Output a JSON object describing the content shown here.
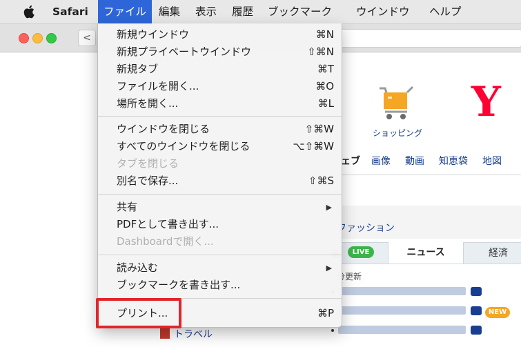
{
  "menubar": {
    "apple_icon": "apple-logo-icon",
    "app_name": "Safari",
    "items": [
      "ファイル",
      "編集",
      "表示",
      "履歴",
      "ブックマーク",
      "ウインドウ",
      "ヘルプ"
    ]
  },
  "window": {
    "back_glyph": "<"
  },
  "file_menu": {
    "group1": [
      {
        "label": "新規ウインドウ",
        "shortcut": "⌘N"
      },
      {
        "label": "新規プライベートウインドウ",
        "shortcut": "⇧⌘N"
      },
      {
        "label": "新規タブ",
        "shortcut": "⌘T"
      },
      {
        "label": "ファイルを開く...",
        "shortcut": "⌘O"
      },
      {
        "label": "場所を開く...",
        "shortcut": "⌘L"
      }
    ],
    "group2": [
      {
        "label": "ウインドウを閉じる",
        "shortcut": "⇧⌘W"
      },
      {
        "label": "すべてのウインドウを閉じる",
        "shortcut": "⌥⇧⌘W"
      },
      {
        "label": "タブを閉じる",
        "shortcut": ""
      },
      {
        "label": "別名で保存...",
        "shortcut": "⇧⌘S"
      }
    ],
    "group3": [
      {
        "label": "共有",
        "submenu_arrow": "▶"
      },
      {
        "label": "PDFとして書き出す...",
        "shortcut": ""
      },
      {
        "label": "Dashboardで開く...",
        "shortcut": ""
      }
    ],
    "group4": [
      {
        "label": "読み込む",
        "submenu_arrow": "▶"
      },
      {
        "label": "ブックマークを書き出す...",
        "shortcut": ""
      }
    ],
    "group5": [
      {
        "label": "プリント...",
        "shortcut": "⌘P"
      }
    ]
  },
  "webpage": {
    "shopping_label": "ショッピング",
    "partial_label": "!",
    "nav": [
      "ェブ",
      "画像",
      "動画",
      "知恵袋",
      "地図"
    ],
    "fashion_label": "ファッション",
    "tab_partial": "画",
    "live_badge": "LIVE",
    "tab_news": "ニュース",
    "tab_econ": "経済",
    "updated": "分更新",
    "new_badge": "NEW",
    "travel_label": "トラベル",
    "logo_letter": "Y"
  },
  "colors": {
    "menu_highlight": "#2e66d9",
    "callout_red": "#e0262a",
    "yahoo_red": "#ff0033"
  }
}
